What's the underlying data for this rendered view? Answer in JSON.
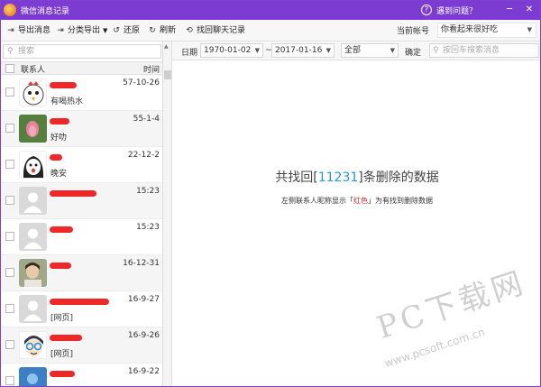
{
  "titlebar": {
    "title": "微信消息记录",
    "help_label": "遇到问题？",
    "help_icon": "?",
    "minimize": "─",
    "close": "✕"
  },
  "toolbar": {
    "export_messages": "导出消息",
    "export_by_category": "分类导出",
    "restore": "还原",
    "refresh": "刷新",
    "recover_chats": "找回聊天记录",
    "account_label": "当前帐号",
    "account_value": "你看起来很好吃"
  },
  "sidebar": {
    "search_placeholder": "搜索",
    "col_contact": "联系人",
    "col_time": "时间",
    "contacts": [
      {
        "time": "57-10-26",
        "message": "有喝热水",
        "avatar": "cartoon-rooster"
      },
      {
        "time": "55-1-4",
        "message": "好叻",
        "avatar": "lotus-flower"
      },
      {
        "time": "22-12-2",
        "message": "晚安",
        "avatar": "cartoon-girl"
      },
      {
        "time": "15:23",
        "message": "",
        "avatar": "default-person"
      },
      {
        "time": "15:23",
        "message": "",
        "avatar": "default-person"
      },
      {
        "time": "16-12-31",
        "message": "",
        "avatar": "photo-person"
      },
      {
        "time": "16-9-27",
        "message": "[网页]",
        "avatar": "default-person"
      },
      {
        "time": "16-9-26",
        "message": "[网页]",
        "avatar": "cartoon-glasses"
      },
      {
        "time": "16-9-22",
        "message": "",
        "avatar": "blue-photo"
      }
    ]
  },
  "filter": {
    "date_label": "日期",
    "date_from": "1970-01-02",
    "separator": "~",
    "date_to": "2017-01-16",
    "category": "全部",
    "confirm": "确定",
    "keyword_placeholder": "按回车搜索消息"
  },
  "main": {
    "headline_prefix": "共找回[",
    "recovered_count": "11231",
    "headline_suffix": "]条删除的数据",
    "hint_prefix": "左侧联系人昵称显示「",
    "hint_red": "红色",
    "hint_suffix": "」为有找到删除数据"
  },
  "watermark": {
    "big": "PC下载网",
    "small": "www.pcsoft.com.cn"
  },
  "colors": {
    "titlebar": "#7c3cd2",
    "highlight_count": "#1e9bd8",
    "deleted_marker": "#ee2828"
  }
}
